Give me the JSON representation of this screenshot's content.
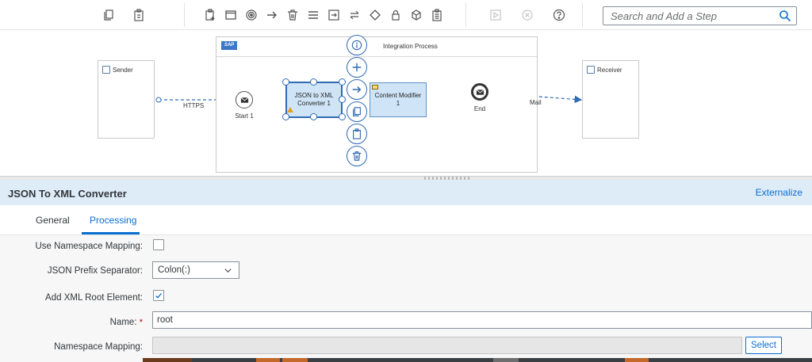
{
  "search": {
    "placeholder": "Search and Add a Step"
  },
  "canvas": {
    "sender_label": "Sender",
    "receiver_label": "Receiver",
    "process_title": "Integration Process",
    "start_label": "Start 1",
    "end_label": "End",
    "task1_label": "JSON to XML Converter 1",
    "task2_label": "Content Modifier 1",
    "conn_https": "HTTPS",
    "conn_mail": "Mail",
    "sap_logo": "SAP"
  },
  "props": {
    "title": "JSON To XML Converter",
    "externalize": "Externalize",
    "tabs": [
      "General",
      "Processing"
    ],
    "active_tab": "Processing",
    "fields": {
      "use_namespace_mapping": {
        "label": "Use Namespace Mapping:",
        "checked": false
      },
      "json_prefix_separator": {
        "label": "JSON Prefix Separator:",
        "value": "Colon(:)"
      },
      "add_xml_root": {
        "label": "Add XML Root Element:",
        "checked": true
      },
      "name": {
        "label": "Name:",
        "required_mark": "*",
        "value": "root"
      },
      "namespace_mapping": {
        "label": "Namespace Mapping:",
        "value": "",
        "button": "Select"
      }
    }
  },
  "colors": {
    "accent": "#0a6ed1",
    "header_bg": "#deecf8",
    "task_fill": "#cfe5f7",
    "required": "#bb0000"
  }
}
